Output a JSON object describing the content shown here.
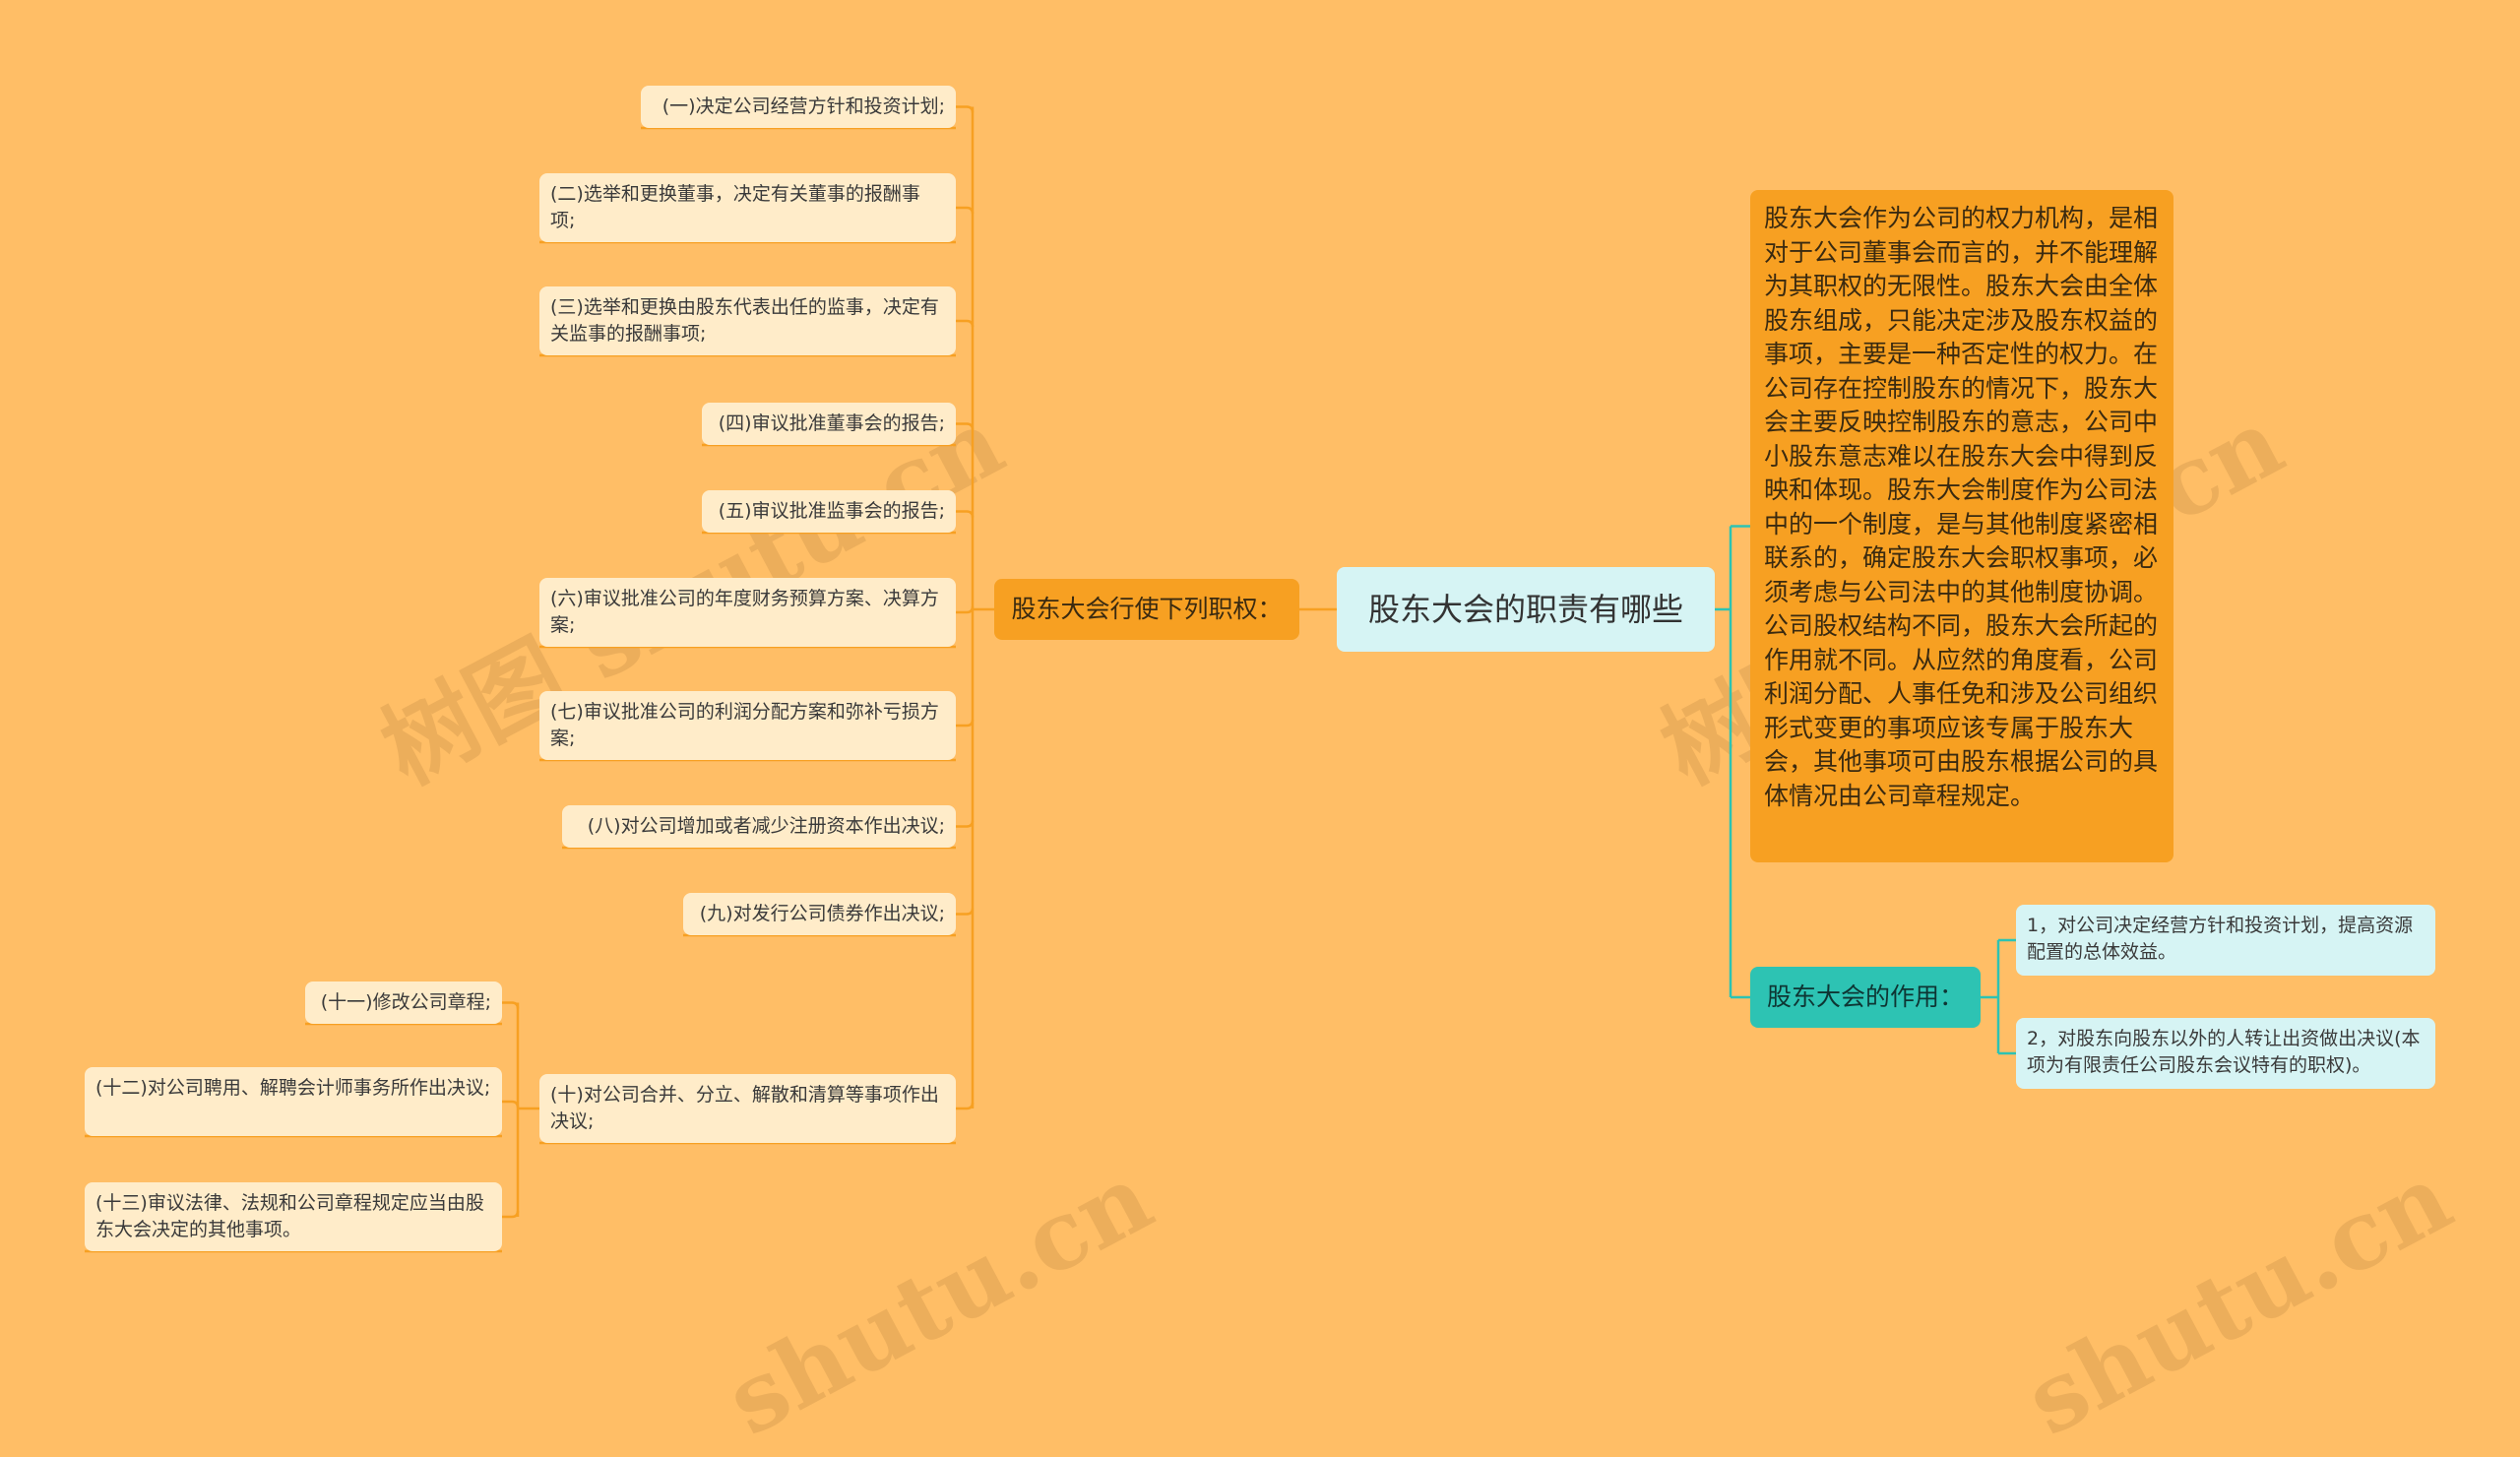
{
  "root": {
    "title": "股东大会的职责有哪些"
  },
  "left_branch": {
    "label": "股东大会行使下列职权：",
    "items": [
      "(一)决定公司经营方针和投资计划;",
      "(二)选举和更换董事，决定有关董事的报酬事项;",
      "(三)选举和更换由股东代表出任的监事，决定有关监事的报酬事项;",
      "(四)审议批准董事会的报告;",
      "(五)审议批准监事会的报告;",
      "(六)审议批准公司的年度财务预算方案、决算方案;",
      "(七)审议批准公司的利润分配方案和弥补亏损方案;",
      "(八)对公司增加或者减少注册资本作出决议;",
      "(九)对发行公司债券作出决议;",
      "(十)对公司合并、分立、解散和清算等事项作出决议;"
    ],
    "sub_items": [
      "(十一)修改公司章程;",
      "(十二)对公司聘用、解聘会计师事务所作出决议;",
      "(十三)审议法律、法规和公司章程规定应当由股东大会决定的其他事项。"
    ]
  },
  "right_desc": {
    "text": "股东大会作为公司的权力机构，是相对于公司董事会而言的，并不能理解为其职权的无限性。股东大会由全体股东组成，只能决定涉及股东权益的事项，主要是一种否定性的权力。在公司存在控制股东的情况下，股东大会主要反映控制股东的意志，公司中小股东意志难以在股东大会中得到反映和体现。股东大会制度作为公司法中的一个制度，是与其他制度紧密相联系的，确定股东大会职权事项，必须考虑与公司法中的其他制度协调。公司股权结构不同，股东大会所起的作用就不同。从应然的角度看，公司利润分配、人事任免和涉及公司组织形式变更的事项应该专属于股东大会，其他事项可由股东根据公司的具体情况由公司章程规定。"
  },
  "right_branch": {
    "label": "股东大会的作用：",
    "items": [
      "1，对公司决定经营方针和投资计划，提高资源配置的总体效益。",
      "2，对股东向股东以外的人转让出资做出决议(本项为有限责任公司股东会议特有的职权)。"
    ]
  },
  "watermarks": [
    "树图 shutu.cn",
    "树图 shutu.cn",
    "shutu.cn",
    "shutu.cn"
  ],
  "colors": {
    "background": "#FFBE66",
    "orange_line": "#F7A022",
    "teal_line": "#2DC3B3"
  }
}
